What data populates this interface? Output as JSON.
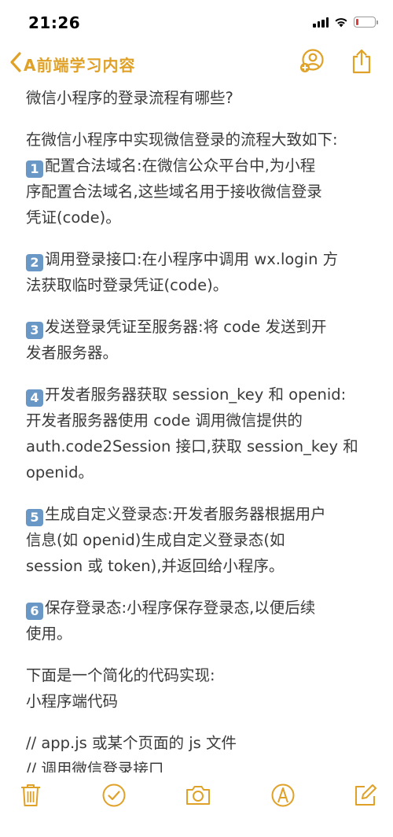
{
  "status_bar": {
    "time": "21:26",
    "icons": [
      "signal-icon",
      "wifi-icon",
      "battery-icon"
    ],
    "battery_color": "#e23b3b"
  },
  "nav": {
    "back_label": "A前端学习内容",
    "accent_color": "#e0a128",
    "actions": [
      "share-person-icon",
      "export-icon"
    ]
  },
  "note": {
    "lines": [
      {
        "text": "微信小程序的登录流程有哪些?"
      },
      {
        "blank": true
      },
      {
        "text": "在微信小程序中实现微信登录的流程大致如下:"
      },
      {
        "badge": "1",
        "text": "配置合法域名:在微信公众平台中,为小程"
      },
      {
        "text": "序配置合法域名,这些域名用于接收微信登录"
      },
      {
        "text": "凭证(code)。"
      },
      {
        "blank": true
      },
      {
        "badge": "2",
        "text": "调用登录接口:在小程序中调用 wx.login 方"
      },
      {
        "text": "法获取临时登录凭证(code)。"
      },
      {
        "blank": true
      },
      {
        "badge": "3",
        "text": "发送登录凭证至服务器:将 code 发送到开"
      },
      {
        "text": "发者服务器。"
      },
      {
        "blank": true
      },
      {
        "badge": "4",
        "text": "开发者服务器获取 session_key 和 openid:"
      },
      {
        "text": "开发者服务器使用 code 调用微信提供的"
      },
      {
        "text": "auth.code2Session 接口,获取 session_key 和"
      },
      {
        "text": "openid。"
      },
      {
        "blank": true
      },
      {
        "badge": "5",
        "text": "生成自定义登录态:开发者服务器根据用户"
      },
      {
        "text": "信息(如 openid)生成自定义登录态(如"
      },
      {
        "text": "session 或 token),并返回给小程序。"
      },
      {
        "blank": true
      },
      {
        "badge": "6",
        "text": "保存登录态:小程序保存登录态,以便后续"
      },
      {
        "text": "使用。"
      },
      {
        "blank": true
      },
      {
        "text": "下面是一个简化的代码实现:"
      },
      {
        "text": "小程序端代码"
      },
      {
        "blank": true
      },
      {
        "text": "// app.js 或某个页面的 js 文件"
      },
      {
        "text": "// 调用微信登录接口"
      }
    ]
  },
  "toolbar": {
    "items": [
      "trash-icon",
      "checklist-icon",
      "camera-icon",
      "markup-icon",
      "compose-icon"
    ]
  }
}
